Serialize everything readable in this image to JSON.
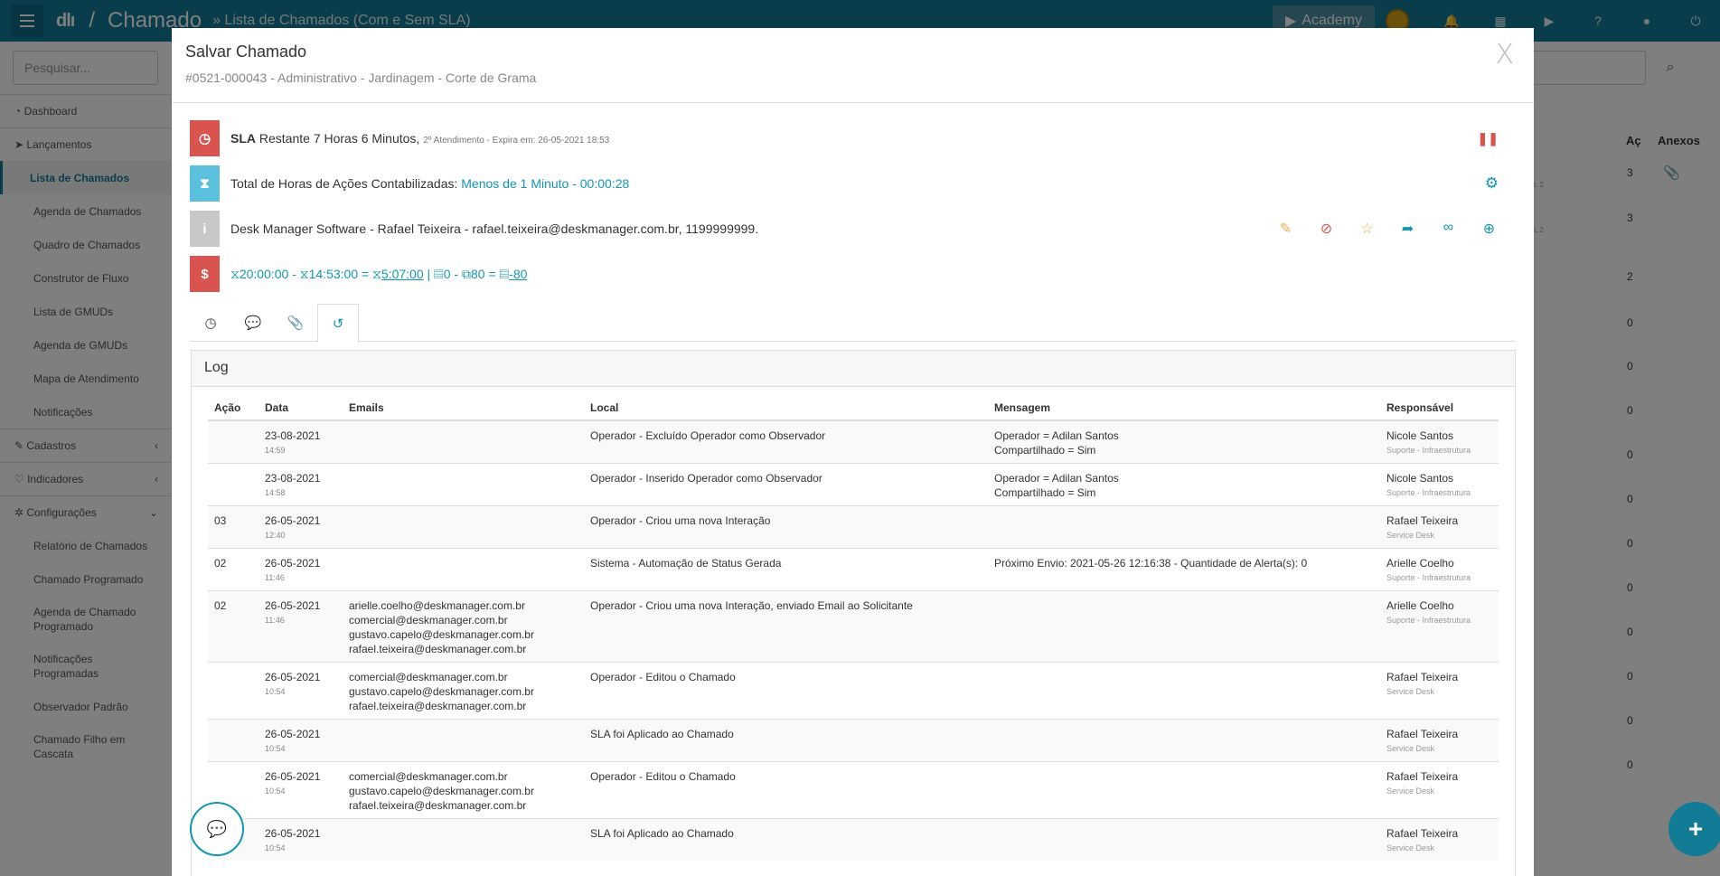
{
  "topbar": {
    "logo": "dlı",
    "separator": "/",
    "title": "Chamado",
    "subtitle": "» Lista de Chamados (Com e Sem SLA)",
    "academy": "Academy"
  },
  "sidebar": {
    "search_placeholder": "Pesquisar...",
    "items": [
      {
        "label": "Dashboard"
      },
      {
        "label": "Lançamentos"
      },
      {
        "label": "Lista de Chamados"
      },
      {
        "label": "Agenda de Chamados"
      },
      {
        "label": "Quadro de Chamados"
      },
      {
        "label": "Construtor de Fluxo"
      },
      {
        "label": "Lista de GMUDs"
      },
      {
        "label": "Agenda de GMUDs"
      },
      {
        "label": "Mapa de Atendimento"
      },
      {
        "label": "Notificações"
      },
      {
        "label": "Cadastros"
      },
      {
        "label": "Indicadores"
      },
      {
        "label": "Configurações"
      },
      {
        "label": "Relatório de Chamados"
      },
      {
        "label": "Chamado Programado"
      },
      {
        "label": "Agenda de Chamado Programado"
      },
      {
        "label": "Notificações Programadas"
      },
      {
        "label": "Observador Padrão"
      },
      {
        "label": "Chamado Filho em Cascata"
      }
    ]
  },
  "background": {
    "col_ac": "Aç",
    "col_anexos": "Anexos",
    "values": [
      "3",
      "3",
      "2",
      "0",
      "0",
      "0",
      "0",
      "0",
      "0",
      "0",
      "0",
      "0",
      "0",
      "0"
    ],
    "fragments": [
      "L 2",
      "L 2"
    ]
  },
  "modal": {
    "title": "Salvar Chamado",
    "subtitle": "#0521-000043 - Administrativo - Jardinagem - Corte de Grama",
    "close": "X",
    "sla": {
      "label": "SLA",
      "text": "Restante 7 Horas 6 Minutos,",
      "detail": "2º Atendimento - Expira em: 26-05-2021 18:53"
    },
    "hours": {
      "label": "Total de Horas de Ações Contabilizadas:",
      "value": "Menos de 1 Minuto - 00:00:28"
    },
    "contact": {
      "text": "Desk Manager Software - Rafael Teixeira - rafael.teixeira@deskmanager.com.br, 1199999999."
    },
    "cost": {
      "t1": "20:00:00",
      "sep1": "-",
      "t2": "14:53:00",
      "eq": "=",
      "t3": "5:07:00",
      "pipe": "|",
      "v1": "0",
      "sep2": "-",
      "v2": "80",
      "sep3": "=",
      "v3": "-80"
    },
    "log": {
      "title": "Log",
      "headers": [
        "Ação",
        "Data",
        "Emails",
        "Local",
        "Mensagem",
        "Responsável"
      ],
      "rows": [
        {
          "acao": "",
          "data": "23-08-2021",
          "hora": "14:59",
          "emails": "",
          "local": "Operador - Excluído Operador como Observador",
          "mensagem": "Operador = Adilan Santos\nCompartilhado = Sim",
          "resp": "Nicole Santos",
          "role": "Suporte - Infraestrutura"
        },
        {
          "acao": "",
          "data": "23-08-2021",
          "hora": "14:58",
          "emails": "",
          "local": "Operador - Inserido Operador como Observador",
          "mensagem": "Operador = Adilan Santos\nCompartilhado = Sim",
          "resp": "Nicole Santos",
          "role": "Suporte - Infraestrutura"
        },
        {
          "acao": "03",
          "data": "26-05-2021",
          "hora": "12:40",
          "emails": "",
          "local": "Operador - Criou uma nova Interação",
          "mensagem": "",
          "resp": "Rafael Teixeira",
          "role": "Service Desk"
        },
        {
          "acao": "02",
          "data": "26-05-2021",
          "hora": "11:46",
          "emails": "",
          "local": "Sistema - Automação de Status Gerada",
          "mensagem": "Próximo Envio: 2021-05-26 12:16:38 - Quantidade de Alerta(s): 0",
          "resp": "Arielle Coelho",
          "role": "Suporte - Infraestrutura"
        },
        {
          "acao": "02",
          "data": "26-05-2021",
          "hora": "11:46",
          "emails": "arielle.coelho@deskmanager.com.br\ncomercial@deskmanager.com.br\ngustavo.capelo@deskmanager.com.br\nrafael.teixeira@deskmanager.com.br",
          "local": "Operador - Criou uma nova Interação, enviado Email ao Solicitante",
          "mensagem": "",
          "resp": "Arielle Coelho",
          "role": "Suporte - Infraestrutura"
        },
        {
          "acao": "",
          "data": "26-05-2021",
          "hora": "10:54",
          "emails": "comercial@deskmanager.com.br\ngustavo.capelo@deskmanager.com.br\nrafael.teixeira@deskmanager.com.br",
          "local": "Operador - Editou o Chamado",
          "mensagem": "",
          "resp": "Rafael Teixeira",
          "role": "Service Desk"
        },
        {
          "acao": "",
          "data": "26-05-2021",
          "hora": "10:54",
          "emails": "",
          "local": "SLA foi Aplicado ao Chamado",
          "mensagem": "",
          "resp": "Rafael Teixeira",
          "role": "Service Desk"
        },
        {
          "acao": "",
          "data": "26-05-2021",
          "hora": "10:54",
          "emails": "comercial@deskmanager.com.br\ngustavo.capelo@deskmanager.com.br\nrafael.teixeira@deskmanager.com.br",
          "local": "Operador - Editou o Chamado",
          "mensagem": "",
          "resp": "Rafael Teixeira",
          "role": "Service Desk"
        },
        {
          "acao": "",
          "data": "26-05-2021",
          "hora": "10:54",
          "emails": "",
          "local": "SLA foi Aplicado ao Chamado",
          "mensagem": "",
          "resp": "Rafael Teixeira",
          "role": "Service Desk"
        }
      ]
    }
  },
  "colors": {
    "brand": "#127b96",
    "accent": "#1296b3",
    "sla_red": "#d9534f",
    "info_teal": "#5bc0de",
    "gray": "#c8c8c8",
    "orange": "#f0ad4e"
  }
}
